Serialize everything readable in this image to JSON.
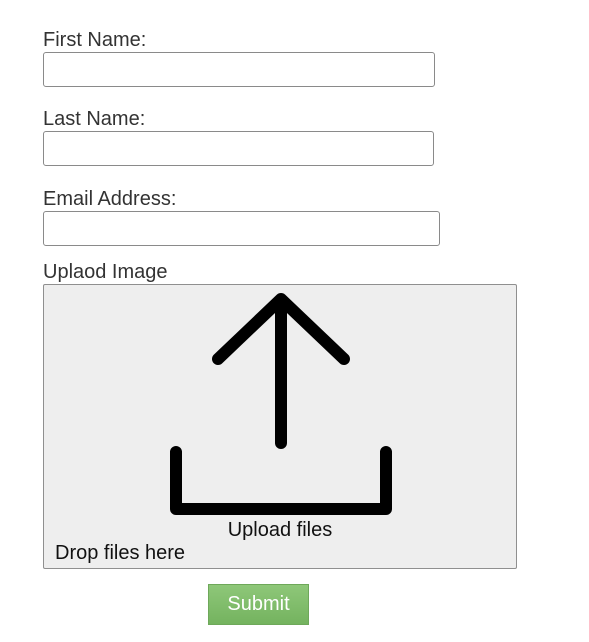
{
  "form": {
    "first_name": {
      "label": "First Name:",
      "value": "",
      "placeholder": ""
    },
    "last_name": {
      "label": "Last Name:",
      "value": "",
      "placeholder": ""
    },
    "email": {
      "label": "Email Address:",
      "value": "",
      "placeholder": ""
    },
    "upload": {
      "label": "Uplaod Image",
      "icon": "upload-icon",
      "caption": "Upload files",
      "drop_hint": "Drop files here",
      "background_color": "#eeeeee"
    },
    "submit_label": "Submit",
    "submit_color": "#7fbd69"
  }
}
